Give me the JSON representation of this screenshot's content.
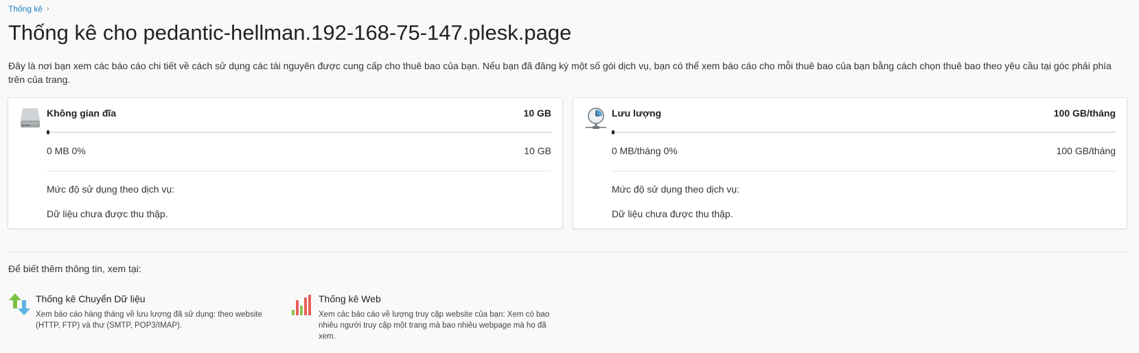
{
  "breadcrumb": {
    "items": [
      "Thống kê"
    ]
  },
  "page": {
    "title": "Thống kê cho pedantic-hellman.192-168-75-147.plesk.page",
    "description": "Đây là nơi bạn xem các báo cáo chi tiết về cách sử dụng các tài nguyên được cung cấp cho thuê bao của bạn. Nếu bạn đã đăng ký một số gói dịch vụ, bạn có thể xem báo cáo cho mỗi thuê bao của bạn bằng cách chọn thuê bao theo yêu cầu tại góc phải phía trên của trang."
  },
  "cards": {
    "disk": {
      "icon": "hard-disk-icon",
      "label": "Không gian đĩa",
      "limit": "10 GB",
      "usage_fraction": 0,
      "used": "0 MB 0%",
      "total": "10 GB",
      "per_service_label": "Mức độ sử dụng theo dịch vụ:",
      "no_data": "Dữ liệu chưa được thu thập."
    },
    "traffic": {
      "icon": "traffic-clock-icon",
      "label": "Lưu lượng",
      "limit": "100 GB/tháng",
      "usage_fraction": 0,
      "used": "0 MB/tháng 0%",
      "total": "100 GB/tháng",
      "per_service_label": "Mức độ sử dụng theo dịch vụ:",
      "no_data": "Dữ liệu chưa được thu thập."
    }
  },
  "more_info": {
    "label": "Để biết thêm thông tin, xem tại:",
    "links": [
      {
        "icon": "transfer-arrows-icon",
        "title": "Thống kê Chuyển Dữ liệu",
        "description": "Xem báo cáo hàng tháng về lưu lượng đã sử dụng: theo website (HTTP, FTP) và thư (SMTP, POP3/IMAP)."
      },
      {
        "icon": "web-stats-bars-icon",
        "title": "Thống kê Web",
        "description": "Xem các báo cáo về lượng truy cập website của bạn: Xem có bao nhiêu người truy cập một trang mà bao nhiêu webpage mà họ đã xem."
      }
    ]
  },
  "colors": {
    "link": "#1c7fbf",
    "bar_track": "#e0e0e0",
    "bar_fill": "#222222",
    "transfer_up": "#7cc242",
    "transfer_down": "#5ab4e5",
    "web_bar_red": "#e8605a",
    "web_bar_green": "#8cc152"
  }
}
